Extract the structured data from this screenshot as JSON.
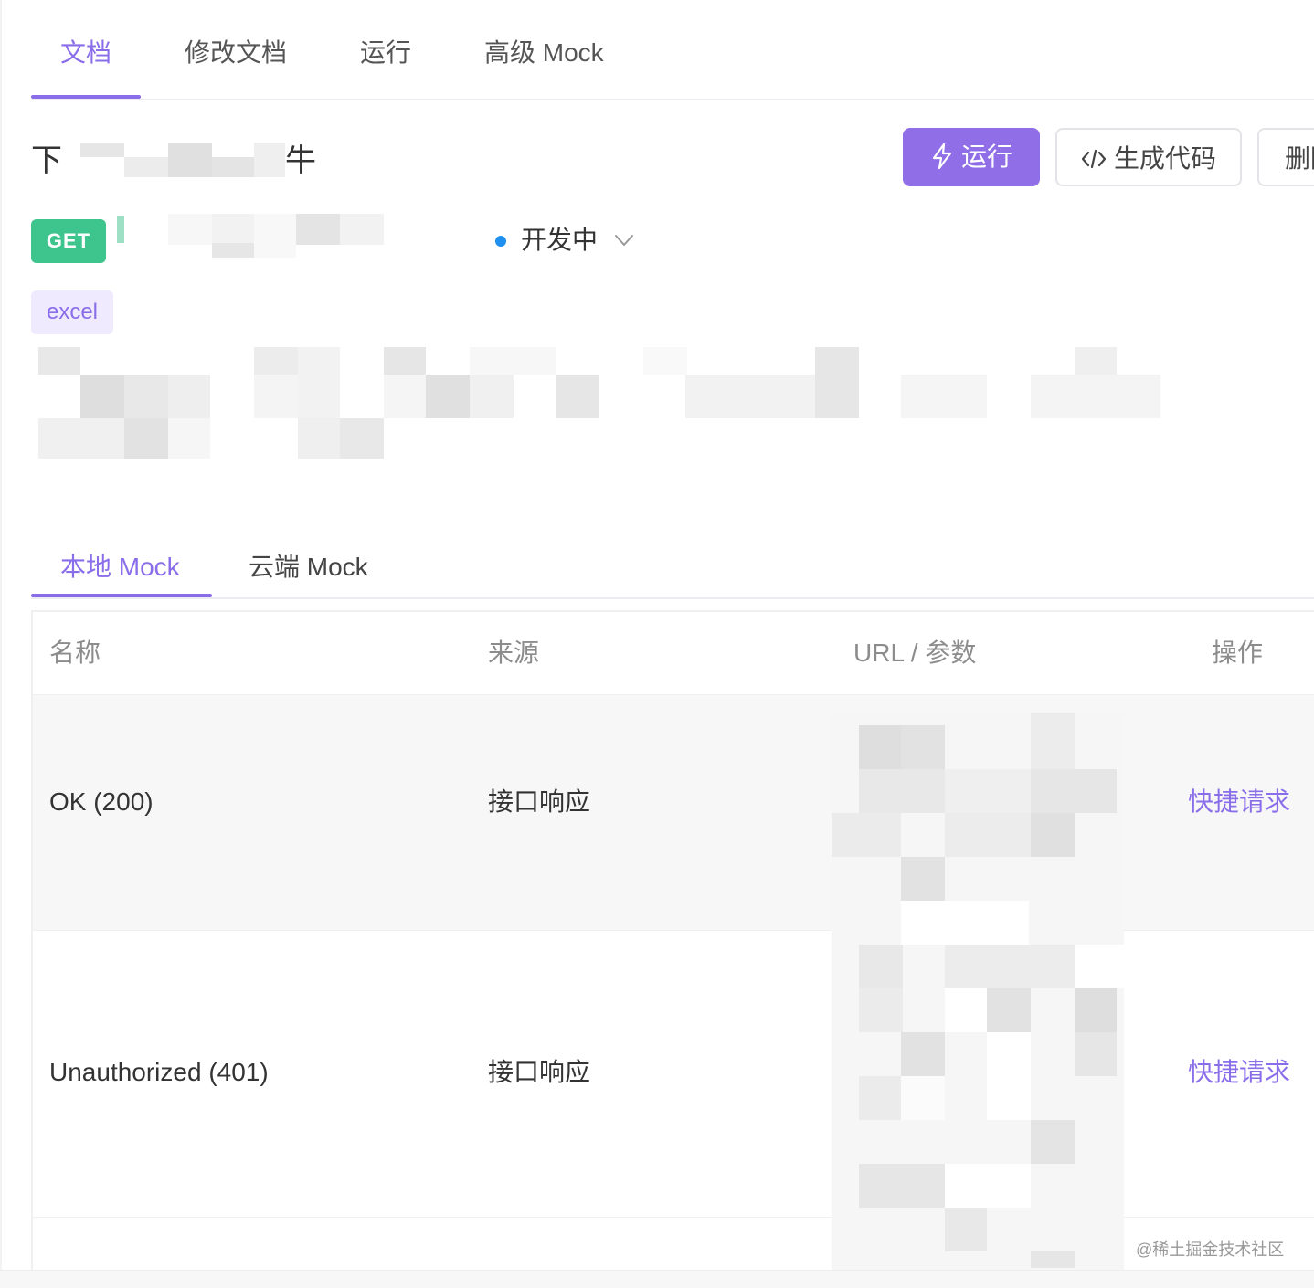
{
  "top_tabs": {
    "items": [
      {
        "label": "文档"
      },
      {
        "label": "修改文档"
      },
      {
        "label": "运行"
      },
      {
        "label": "高级 Mock"
      }
    ]
  },
  "api": {
    "title_prefix": "下",
    "title_suffix": "牛",
    "method": "GET",
    "status": "开发中",
    "tag": "excel"
  },
  "actions": {
    "run_label": "运行",
    "code_label": "生成代码",
    "delete_label": "删除"
  },
  "mock_tabs": {
    "items": [
      {
        "label": "本地 Mock"
      },
      {
        "label": "云端 Mock"
      }
    ]
  },
  "table": {
    "columns": [
      "名称",
      "来源",
      "URL / 参数",
      "操作"
    ],
    "rows": [
      {
        "name": "OK (200)",
        "source": "接口响应",
        "action": "快捷请求"
      },
      {
        "name": "Unauthorized (401)",
        "source": "接口响应",
        "action": "快捷请求"
      }
    ]
  },
  "watermark": "@稀土掘金技术社区",
  "colors": {
    "accent": "#8a6de9",
    "method_get": "#3ec48d",
    "status_dot": "#1f8ff0"
  }
}
